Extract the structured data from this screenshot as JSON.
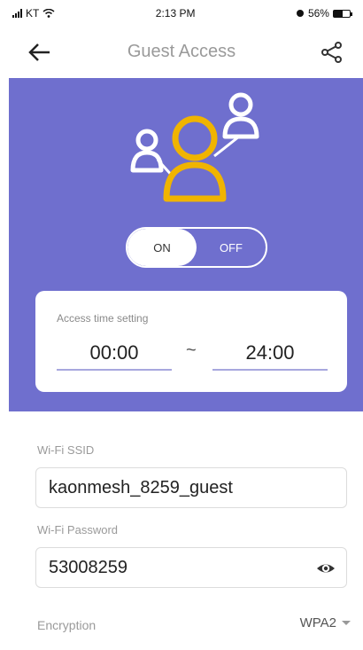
{
  "status_bar": {
    "carrier": "KT",
    "time": "2:13 PM",
    "battery": "56%",
    "battery_level": 0.56
  },
  "nav": {
    "title": "Guest Access"
  },
  "toggle": {
    "on_label": "ON",
    "off_label": "OFF",
    "state": "on"
  },
  "access_time": {
    "label": "Access time setting",
    "start": "00:00",
    "separator": "~",
    "end": "24:00"
  },
  "wifi": {
    "ssid_label": "Wi-Fi SSID",
    "ssid": "kaonmesh_8259_guest",
    "password_label": "Wi-Fi Password",
    "password": "53008259",
    "encryption_label": "Encryption",
    "encryption": "WPA2"
  },
  "colors": {
    "hero_bg": "#6f6fce",
    "accent": "#f0b400",
    "field_border": "#dcdcdc"
  },
  "icons": {
    "back": "arrow-left-icon",
    "share": "share-icon",
    "hero": "users-icon",
    "eye": "eye-icon",
    "caret": "chevron-down-icon"
  }
}
